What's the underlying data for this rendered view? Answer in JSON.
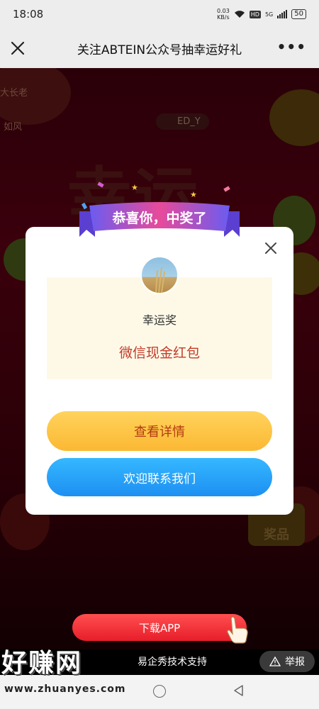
{
  "status_bar": {
    "time": "18:08",
    "speed_value": "0.03",
    "speed_unit": "KB/s",
    "hd": "HD",
    "network": "5G",
    "battery": "50"
  },
  "nav": {
    "title": "关注ABTEIN公众号抽幸运好礼",
    "more": "•••"
  },
  "background": {
    "ticker1": "大长老",
    "ticker2": "如风",
    "user": "ED_Y",
    "big_text": "幸运",
    "prize_tag": "奖品"
  },
  "modal": {
    "banner": "恭喜你，中奖了",
    "prize_level": "幸运奖",
    "prize_name": "微信现金红包",
    "detail_button": "查看详情",
    "contact_button": "欢迎联系我们"
  },
  "bottom": {
    "download_button": "下载APP",
    "footer_text": "易企秀技术支持",
    "report_button": "举报"
  },
  "watermark": {
    "logo": "好赚网",
    "url": "www.zhuanyes.com"
  },
  "colors": {
    "nav_bg": "#ededed",
    "prize_red": "#c33a2a",
    "button_yellow": "#fbb833",
    "button_blue": "#1d8ff2",
    "download_red": "#e71d2a"
  }
}
